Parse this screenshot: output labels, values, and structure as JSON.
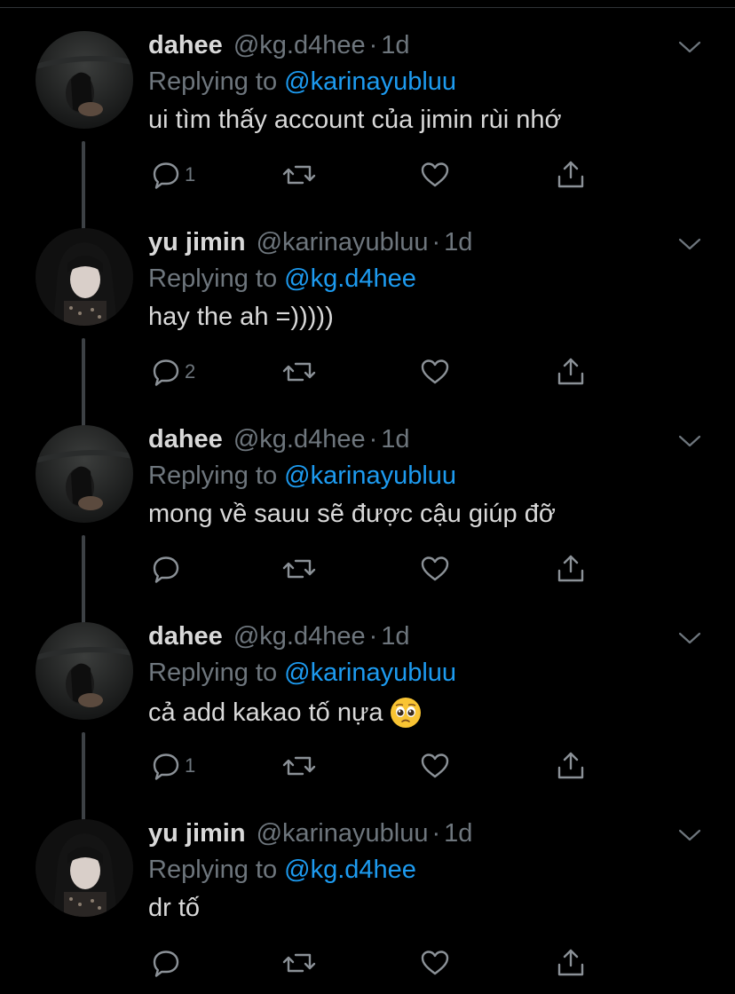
{
  "tweets": [
    {
      "name": "dahee",
      "handle": "@kg.d4hee",
      "time": "1d",
      "reply_prefix": "Replying to",
      "reply_to": "@karinayubluu",
      "text": "ui tìm thấy account của jimin rùi nhớ",
      "reply_count": "1",
      "avatar_icon": "avatar-dahee",
      "has_emoji": false
    },
    {
      "name": "yu jimin",
      "handle": "@karinayubluu",
      "time": "1d",
      "reply_prefix": "Replying to",
      "reply_to": "@kg.d4hee",
      "text": "hay the ah =)))))",
      "reply_count": "2",
      "avatar_icon": "avatar-jimin",
      "has_emoji": false
    },
    {
      "name": "dahee",
      "handle": "@kg.d4hee",
      "time": "1d",
      "reply_prefix": "Replying to",
      "reply_to": "@karinayubluu",
      "text": "mong về sauu sẽ được cậu giúp đỡ",
      "reply_count": "",
      "avatar_icon": "avatar-dahee",
      "has_emoji": false
    },
    {
      "name": "dahee",
      "handle": "@kg.d4hee",
      "time": "1d",
      "reply_prefix": "Replying to",
      "reply_to": "@karinayubluu",
      "text": "cả add kakao tố nựa",
      "reply_count": "1",
      "avatar_icon": "avatar-dahee",
      "has_emoji": true,
      "emoji_icon": "pleading-face-emoji"
    },
    {
      "name": "yu jimin",
      "handle": "@karinayubluu",
      "time": "1d",
      "reply_prefix": "Replying to",
      "reply_to": "@kg.d4hee",
      "text": "dr tố",
      "reply_count": "",
      "avatar_icon": "avatar-jimin",
      "has_emoji": false
    }
  ],
  "colors": {
    "background": "#000000",
    "primary_text": "#d9d9d9",
    "secondary_text": "#6e767d",
    "mention": "#1d9bf0",
    "thread_line": "#3d4145"
  }
}
